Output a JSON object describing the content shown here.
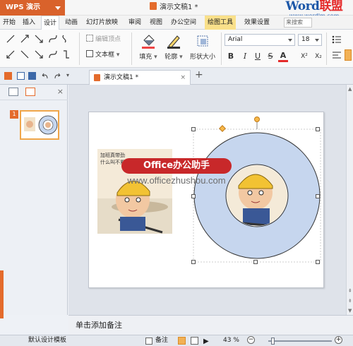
{
  "app": {
    "menu_label": "WPS 演示",
    "doc_title": "演示文稿1 *"
  },
  "brand": {
    "line1_blue": "Word",
    "line1_red": "联盟",
    "line2": "www.wordlm.com"
  },
  "menubar": {
    "items": [
      "开始",
      "插入",
      "设计",
      "动画",
      "幻灯片放映",
      "审阅",
      "视图",
      "办公空间",
      "绘图工具",
      "效果设置"
    ],
    "search_placeholder": "来搜索"
  },
  "ribbon": {
    "edit_vertex": "编辑顶点",
    "textbox": "文本框",
    "fill": "填充",
    "outline": "轮廓",
    "shape_size": "形状大小",
    "font_name": "Arial",
    "font_size": "18",
    "format_buttons": [
      "B",
      "I",
      "U",
      "S",
      "A",
      "X²",
      "X₂"
    ]
  },
  "tabbar": {
    "doc_tab": "演示文稿1 *",
    "add": "+"
  },
  "leftpane": {
    "slide_number": "1"
  },
  "watermark": {
    "badge": "Office办公助手",
    "url": "www.officezhushou.com"
  },
  "slide": {
    "caption_line1": "加班真带劲",
    "caption_line2": "什么叫不累"
  },
  "notes": {
    "placeholder": "单击添加备注"
  },
  "status": {
    "template": "默认设计模板",
    "notes_btn": "备注",
    "zoom": "43 %"
  },
  "colors": {
    "accent": "#e46b2c",
    "ring": "#c6d6ee",
    "brand_blue": "#1c57a8",
    "brand_red": "#e52b2b",
    "badge": "#c8282a"
  }
}
